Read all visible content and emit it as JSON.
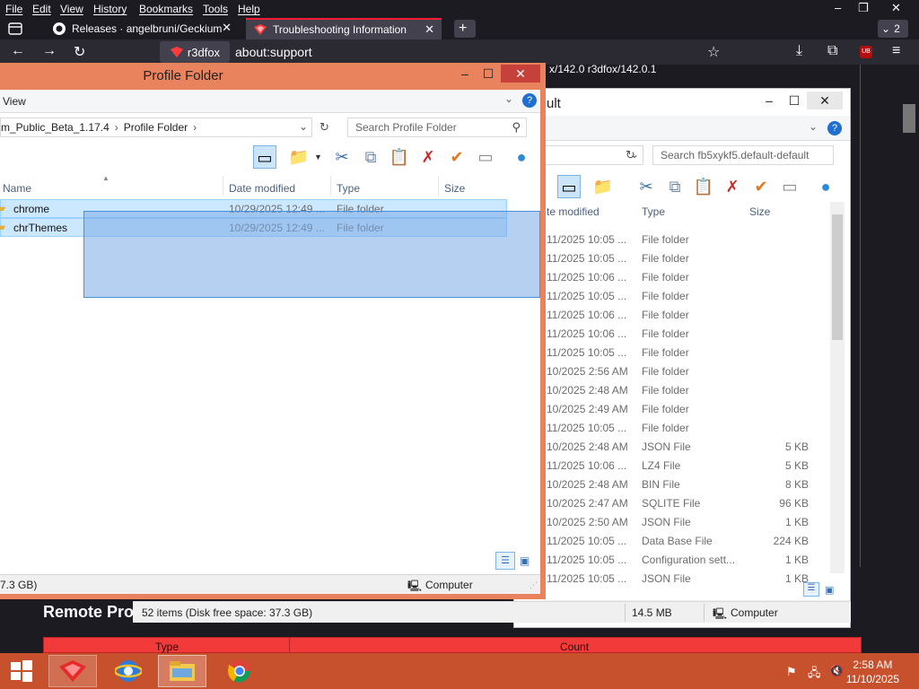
{
  "browser": {
    "menu": [
      "File",
      "Edit",
      "View",
      "History",
      "Bookmarks",
      "Tools",
      "Help"
    ],
    "tabs": [
      {
        "label": "Releases · angelbruni/Geckium",
        "active": false
      },
      {
        "label": "Troubleshooting Information",
        "active": true
      }
    ],
    "tab_overflow_count": "2",
    "identity_label": "r3dfox",
    "url": "about:support",
    "page_version_text": "x/142.0 r3dfox/142.0.1",
    "page_heading": "Remote Pro",
    "page_table_headers": [
      "Type",
      "Count"
    ],
    "addon_badge": "UB"
  },
  "window_front": {
    "title": "Profile Folder",
    "ribbon_label": "View",
    "address_parts": [
      "m_Public_Beta_1.17.4",
      "Profile Folder"
    ],
    "search_placeholder": "Search Profile Folder",
    "columns": [
      "Name",
      "Date modified",
      "Type",
      "Size"
    ],
    "rows": [
      {
        "name": "chrome",
        "date": "10/29/2025 12:49 ...",
        "type": "File folder",
        "size": ""
      },
      {
        "name": "chrThemes",
        "date": "10/29/2025 12:49 ...",
        "type": "File folder",
        "size": ""
      }
    ],
    "status_left": "7.3 GB)",
    "status_right": "Computer"
  },
  "window_back": {
    "title_fragment": "ult",
    "search_placeholder": "Search fb5xykf5.default-default",
    "columns": [
      "te modified",
      "Type",
      "Size"
    ],
    "rows": [
      {
        "date": "11/2025 10:05 ...",
        "type": "File folder",
        "size": ""
      },
      {
        "date": "11/2025 10:05 ...",
        "type": "File folder",
        "size": ""
      },
      {
        "date": "11/2025 10:06 ...",
        "type": "File folder",
        "size": ""
      },
      {
        "date": "11/2025 10:05 ...",
        "type": "File folder",
        "size": ""
      },
      {
        "date": "11/2025 10:06 ...",
        "type": "File folder",
        "size": ""
      },
      {
        "date": "11/2025 10:06 ...",
        "type": "File folder",
        "size": ""
      },
      {
        "date": "11/2025 10:05 ...",
        "type": "File folder",
        "size": ""
      },
      {
        "date": "10/2025 2:56 AM",
        "type": "File folder",
        "size": ""
      },
      {
        "date": "10/2025 2:48 AM",
        "type": "File folder",
        "size": ""
      },
      {
        "date": "10/2025 2:49 AM",
        "type": "File folder",
        "size": ""
      },
      {
        "date": "11/2025 10:05 ...",
        "type": "File folder",
        "size": ""
      },
      {
        "date": "10/2025 2:48 AM",
        "type": "JSON File",
        "size": "5 KB"
      },
      {
        "date": "11/2025 10:06 ...",
        "type": "LZ4 File",
        "size": "5 KB"
      },
      {
        "date": "10/2025 2:48 AM",
        "type": "BIN File",
        "size": "8 KB"
      },
      {
        "date": "10/2025 2:47 AM",
        "type": "SQLITE File",
        "size": "96 KB"
      },
      {
        "date": "10/2025 2:50 AM",
        "type": "JSON File",
        "size": "1 KB"
      },
      {
        "date": "11/2025 10:05 ...",
        "type": "Data Base File",
        "size": "224 KB"
      },
      {
        "date": "11/2025 10:05 ...",
        "type": "Configuration sett...",
        "size": "1 KB"
      },
      {
        "date": "11/2025 10:05 ...",
        "type": "JSON File",
        "size": "1 KB"
      }
    ],
    "status_items": "52 items (Disk free space: 37.3 GB)",
    "status_size": "14.5 MB",
    "status_right": "Computer"
  },
  "taskbar": {
    "time": "2:58 AM",
    "date": "11/10/2025"
  },
  "colors": {
    "front_frame": "#e9835e",
    "back_frame": "#ffffff",
    "selection": "#9cc3ec",
    "taskbar": "#c7502d",
    "browser_dark": "#1c1b22",
    "table_red": "#f23a3a"
  }
}
